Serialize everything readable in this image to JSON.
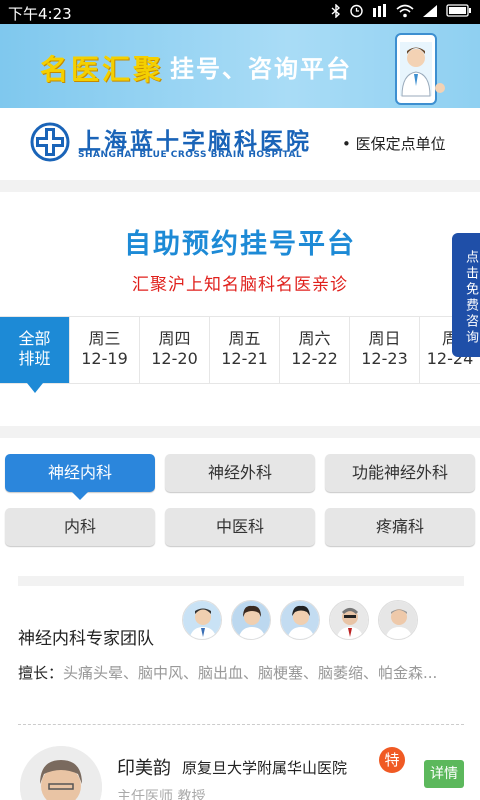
{
  "status_bar": {
    "time": "下午4:23",
    "icons": [
      "bluetooth-icon",
      "alarm-icon",
      "hd-icon",
      "wifi-icon",
      "signal-icon",
      "battery-icon"
    ]
  },
  "banner": {
    "title": "名医汇聚",
    "subtitle": "挂号、咨询平台"
  },
  "hospital": {
    "name_cn": "上海蓝十字脑科医院",
    "name_en": "SHANGHAI BLUE CROSS BRAIN HOSPITAL",
    "note": "• 医保定点单位"
  },
  "booking": {
    "title": "自助预约挂号平台",
    "subtitle": "汇聚沪上知名脑科名医亲诊",
    "float_button": "点击免费咨询"
  },
  "date_tabs": [
    {
      "line1": "全部",
      "line2": "排班",
      "active": true
    },
    {
      "line1": "周三",
      "line2": "12-19"
    },
    {
      "line1": "周四",
      "line2": "12-20"
    },
    {
      "line1": "周五",
      "line2": "12-21"
    },
    {
      "line1": "周六",
      "line2": "12-22"
    },
    {
      "line1": "周日",
      "line2": "12-23"
    },
    {
      "line1": "周",
      "line2": "12-24"
    }
  ],
  "departments": [
    {
      "label": "神经内科",
      "active": true
    },
    {
      "label": "神经外科"
    },
    {
      "label": "功能神经外科"
    },
    {
      "label": "内科"
    },
    {
      "label": "中医科"
    },
    {
      "label": "疼痛科"
    }
  ],
  "team": {
    "title": "神经内科专家团队",
    "skill_label": "擅长：",
    "skill_text": "头痛头晕、脑中风、脑出血、脑梗塞、脑萎缩、帕金森..."
  },
  "doctor": {
    "name": "印美韵",
    "hospital": "原复旦大学附属华山医院",
    "title": "主任医师 教授",
    "badge": "特",
    "detail_button": "详情"
  },
  "colors": {
    "primary": "#1d8ad6",
    "accent_red": "#e0201c",
    "detail_green": "#5cb85c",
    "badge_orange": "#f05a24"
  }
}
